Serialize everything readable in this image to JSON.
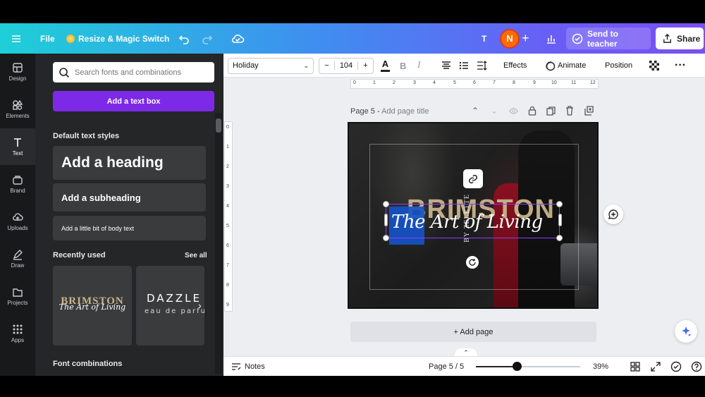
{
  "topbar": {
    "file": "File",
    "resize": "Resize & Magic Switch",
    "user_initial": "T",
    "avatar_initial": "N",
    "send": "Send to teacher",
    "share": "Share"
  },
  "rail": [
    {
      "label": "Design"
    },
    {
      "label": "Elements"
    },
    {
      "label": "Text"
    },
    {
      "label": "Brand"
    },
    {
      "label": "Uploads"
    },
    {
      "label": "Draw"
    },
    {
      "label": "Projects"
    },
    {
      "label": "Apps"
    }
  ],
  "panel": {
    "search_placeholder": "Search fonts and combinations",
    "add_text_box": "Add a text box",
    "default_styles": "Default text styles",
    "heading": "Add a heading",
    "subheading": "Add a subheading",
    "body": "Add a little bit of body text",
    "recently_used": "Recently used",
    "see_all": "See all",
    "card1_title": "BRIMSTON",
    "card1_script": "The Art of Living",
    "card2_title": "DAZZLE",
    "card2_sub": "eau de parfum",
    "font_combinations": "Font combinations"
  },
  "toolbar": {
    "font": "Holiday",
    "size": "104",
    "effects": "Effects",
    "animate": "Animate",
    "position": "Position"
  },
  "ruler_h": [
    "0",
    "1",
    "2",
    "3",
    "4",
    "5",
    "6",
    "7",
    "8",
    "9",
    "10",
    "11",
    "12"
  ],
  "ruler_v": [
    "0",
    "1",
    "2",
    "3",
    "4",
    "5",
    "6",
    "7",
    "8",
    "9"
  ],
  "page": {
    "label": "Page 5",
    "title_placeholder": "Add page title",
    "add_page": "+ Add page"
  },
  "canvas": {
    "brand": "BRIMSTON",
    "script": "The Art of Living",
    "vertical": "BY ZELETTE"
  },
  "bottombar": {
    "notes": "Notes",
    "page_count": "Page 5 / 5",
    "zoom": "39%",
    "zoom_fraction": 0.39
  },
  "colors": {
    "accent_purple": "#7d2ae8",
    "selection": "#8b3dff",
    "gold": "#c9b48a"
  }
}
